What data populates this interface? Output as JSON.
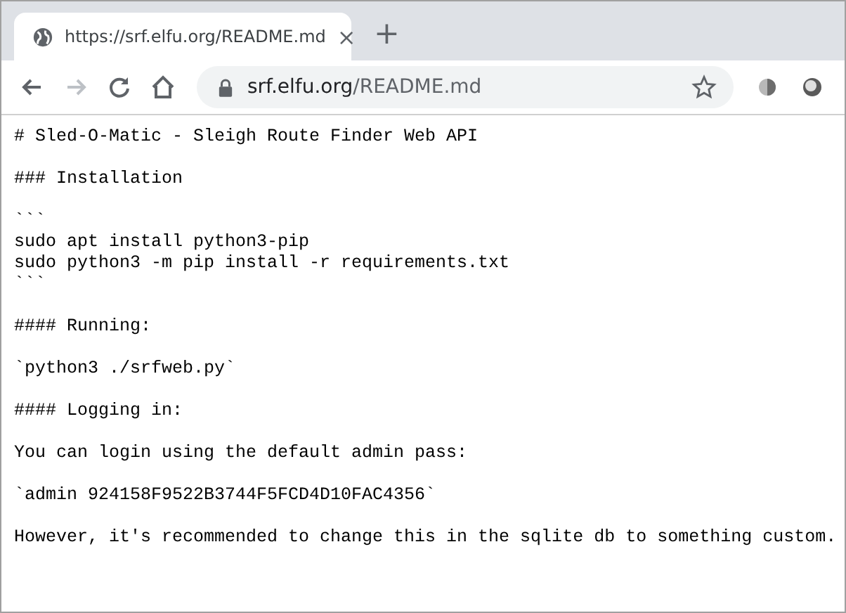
{
  "tab": {
    "title": "https://srf.elfu.org/README.md",
    "close": "×",
    "selected": true
  },
  "new_tab": "+",
  "address_bar": {
    "host": "srf.elfu.org",
    "path": "/README.md"
  },
  "document": {
    "paragraphs": [
      {
        "lines": [
          "# Sled-O-Matic - Sleigh Route Finder Web API"
        ]
      },
      {
        "lines": [
          "### Installation"
        ]
      },
      {
        "lines": [
          "```",
          "sudo apt install python3-pip",
          "sudo python3 -m pip install -r requirements.txt",
          "```"
        ]
      },
      {
        "lines": [
          "#### Running:"
        ]
      },
      {
        "lines": [
          "`python3 ./srfweb.py`"
        ]
      },
      {
        "lines": [
          "#### Logging in:"
        ]
      },
      {
        "lines": [
          "You can login using the default admin pass:"
        ]
      },
      {
        "lines": [
          "`admin 924158F9522B3744F5FCD4D10FAC4356`"
        ]
      },
      {
        "lines": [
          "However, it's recommended to change this in the sqlite db to something custom."
        ]
      }
    ]
  }
}
